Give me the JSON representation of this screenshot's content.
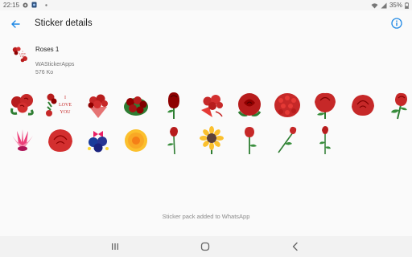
{
  "status": {
    "time": "22:15",
    "battery": "35%",
    "icons": [
      "notification-icon",
      "app-icon",
      "dot-icon",
      "wifi-icon",
      "signal-icon",
      "battery-icon"
    ]
  },
  "appbar": {
    "title": "Sticker details",
    "back_icon": "arrow-back-icon",
    "info_icon": "info-icon"
  },
  "pack": {
    "name": "Roses 1",
    "publisher": "WAStickerApps",
    "size": "576 Ko",
    "tray_text": "I LOVE YOU"
  },
  "stickers": [
    {
      "name": "red-roses-bouquet"
    },
    {
      "name": "i-love-you-roses",
      "text": "I LOVE YOU"
    },
    {
      "name": "roses-gift-bouquet"
    },
    {
      "name": "dark-roses-bunch"
    },
    {
      "name": "single-rosebud"
    },
    {
      "name": "rose-bouquet-ribbon"
    },
    {
      "name": "big-red-rose"
    },
    {
      "name": "rose-dome-bouquet"
    },
    {
      "name": "red-rose-bloom"
    },
    {
      "name": "red-rose-head"
    },
    {
      "name": "rose-with-leaves"
    },
    {
      "name": "pink-lotus"
    },
    {
      "name": "red-rose-large"
    },
    {
      "name": "blue-roses-bow"
    },
    {
      "name": "yellow-marigold"
    },
    {
      "name": "single-rose-stem"
    },
    {
      "name": "sunflower"
    },
    {
      "name": "rose-stem-leaf"
    },
    {
      "name": "long-stem-rose"
    },
    {
      "name": "rosebud-stem"
    }
  ],
  "toast": "Sticker pack added to WhatsApp",
  "nav": {
    "recents_icon": "recents-icon",
    "home_icon": "home-icon",
    "back_icon": "nav-back-icon"
  },
  "colors": {
    "accent": "#1e88e5",
    "rose_red": "#c62828",
    "dark_red": "#8e0000",
    "leaf_green": "#2e7d32",
    "pink": "#ec407a",
    "blue": "#1a3c9a",
    "yellow": "#fbc02d"
  }
}
